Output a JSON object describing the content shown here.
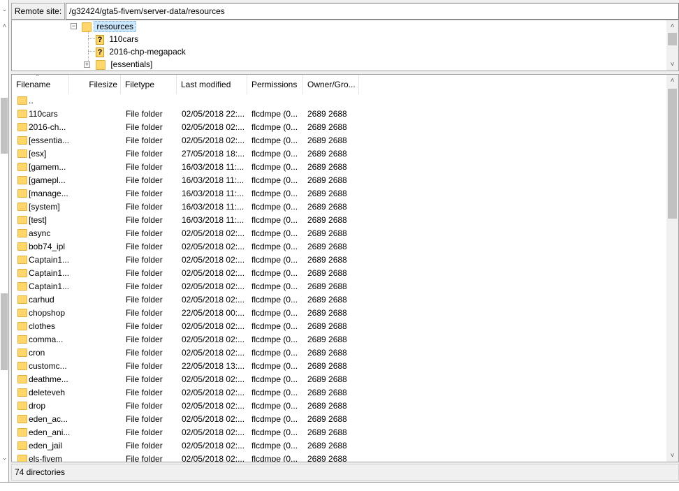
{
  "remote_site": {
    "label": "Remote site:",
    "path": "/g32424/gta5-fivem/server-data/resources"
  },
  "tree": {
    "items": [
      {
        "label": "resources",
        "icon": "folder-icon",
        "expander": "minus"
      },
      {
        "label": "110cars",
        "icon": "unknown-folder-icon"
      },
      {
        "label": "2016-chp-megapack",
        "icon": "unknown-folder-icon"
      },
      {
        "label": "[essentials]",
        "icon": "folder-icon",
        "expander": "plus"
      }
    ]
  },
  "list": {
    "columns": [
      "Filename",
      "Filesize",
      "Filetype",
      "Last modified",
      "Permissions",
      "Owner/Gro..."
    ],
    "parent_label": "..",
    "rows": [
      {
        "name": "110cars",
        "type": "File folder",
        "modified": "02/05/2018 22:...",
        "perms": "flcdmpe (0...",
        "owner": "2689 2688"
      },
      {
        "name": "2016-ch...",
        "type": "File folder",
        "modified": "02/05/2018 02:...",
        "perms": "flcdmpe (0...",
        "owner": "2689 2688"
      },
      {
        "name": "[essentia...",
        "type": "File folder",
        "modified": "02/05/2018 02:...",
        "perms": "flcdmpe (0...",
        "owner": "2689 2688"
      },
      {
        "name": "[esx]",
        "type": "File folder",
        "modified": "27/05/2018 18:...",
        "perms": "flcdmpe (0...",
        "owner": "2689 2688"
      },
      {
        "name": "[gamem...",
        "type": "File folder",
        "modified": "16/03/2018 11:...",
        "perms": "flcdmpe (0...",
        "owner": "2689 2688"
      },
      {
        "name": "[gamepl...",
        "type": "File folder",
        "modified": "16/03/2018 11:...",
        "perms": "flcdmpe (0...",
        "owner": "2689 2688"
      },
      {
        "name": "[manage...",
        "type": "File folder",
        "modified": "16/03/2018 11:...",
        "perms": "flcdmpe (0...",
        "owner": "2689 2688"
      },
      {
        "name": "[system]",
        "type": "File folder",
        "modified": "16/03/2018 11:...",
        "perms": "flcdmpe (0...",
        "owner": "2689 2688"
      },
      {
        "name": "[test]",
        "type": "File folder",
        "modified": "16/03/2018 11:...",
        "perms": "flcdmpe (0...",
        "owner": "2689 2688"
      },
      {
        "name": "async",
        "type": "File folder",
        "modified": "02/05/2018 02:...",
        "perms": "flcdmpe (0...",
        "owner": "2689 2688"
      },
      {
        "name": "bob74_ipl",
        "type": "File folder",
        "modified": "02/05/2018 02:...",
        "perms": "flcdmpe (0...",
        "owner": "2689 2688"
      },
      {
        "name": "Captain1...",
        "type": "File folder",
        "modified": "02/05/2018 02:...",
        "perms": "flcdmpe (0...",
        "owner": "2689 2688"
      },
      {
        "name": "Captain1...",
        "type": "File folder",
        "modified": "02/05/2018 02:...",
        "perms": "flcdmpe (0...",
        "owner": "2689 2688"
      },
      {
        "name": "Captain1...",
        "type": "File folder",
        "modified": "02/05/2018 02:...",
        "perms": "flcdmpe (0...",
        "owner": "2689 2688"
      },
      {
        "name": "carhud",
        "type": "File folder",
        "modified": "02/05/2018 02:...",
        "perms": "flcdmpe (0...",
        "owner": "2689 2688"
      },
      {
        "name": "chopshop",
        "type": "File folder",
        "modified": "22/05/2018 00:...",
        "perms": "flcdmpe (0...",
        "owner": "2689 2688"
      },
      {
        "name": "clothes",
        "type": "File folder",
        "modified": "02/05/2018 02:...",
        "perms": "flcdmpe (0...",
        "owner": "2689 2688"
      },
      {
        "name": "comma...",
        "type": "File folder",
        "modified": "02/05/2018 02:...",
        "perms": "flcdmpe (0...",
        "owner": "2689 2688"
      },
      {
        "name": "cron",
        "type": "File folder",
        "modified": "02/05/2018 02:...",
        "perms": "flcdmpe (0...",
        "owner": "2689 2688"
      },
      {
        "name": "customc...",
        "type": "File folder",
        "modified": "22/05/2018 13:...",
        "perms": "flcdmpe (0...",
        "owner": "2689 2688"
      },
      {
        "name": "deathme...",
        "type": "File folder",
        "modified": "02/05/2018 02:...",
        "perms": "flcdmpe (0...",
        "owner": "2689 2688"
      },
      {
        "name": "deleteveh",
        "type": "File folder",
        "modified": "02/05/2018 02:...",
        "perms": "flcdmpe (0...",
        "owner": "2689 2688"
      },
      {
        "name": "drop",
        "type": "File folder",
        "modified": "02/05/2018 02:...",
        "perms": "flcdmpe (0...",
        "owner": "2689 2688"
      },
      {
        "name": "eden_ac...",
        "type": "File folder",
        "modified": "02/05/2018 02:...",
        "perms": "flcdmpe (0...",
        "owner": "2689 2688"
      },
      {
        "name": "eden_ani...",
        "type": "File folder",
        "modified": "02/05/2018 02:...",
        "perms": "flcdmpe (0...",
        "owner": "2689 2688"
      },
      {
        "name": "eden_jail",
        "type": "File folder",
        "modified": "02/05/2018 02:...",
        "perms": "flcdmpe (0...",
        "owner": "2689 2688"
      },
      {
        "name": "els-fivem",
        "type": "File folder",
        "modified": "02/05/2018 02:...",
        "perms": "flcdmpe (0...",
        "owner": "2689 2688"
      }
    ]
  },
  "status": {
    "text": "74 directories"
  },
  "colors": {
    "folder": "#ffd66b",
    "selection": "#cce8ff"
  }
}
